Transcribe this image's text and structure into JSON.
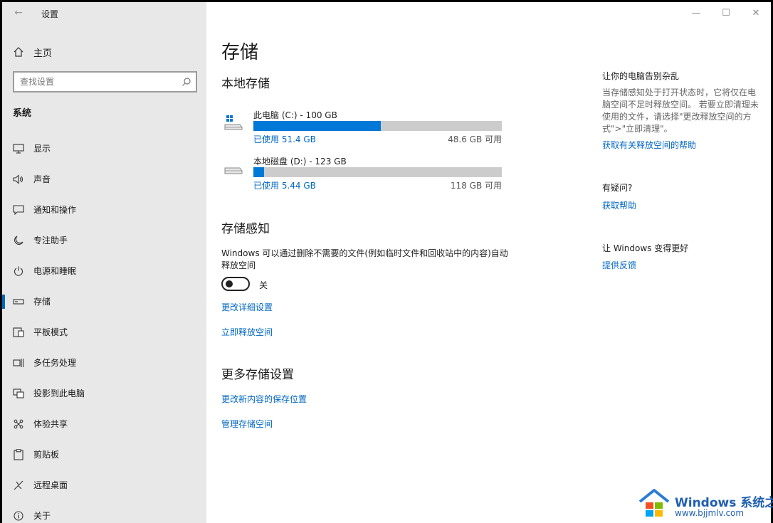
{
  "window": {
    "title": "设置"
  },
  "sidebar": {
    "home_label": "主页",
    "search_placeholder": "查找设置",
    "section": "系统",
    "items": [
      {
        "label": "显示",
        "icon": "monitor-icon"
      },
      {
        "label": "声音",
        "icon": "speaker-icon"
      },
      {
        "label": "通知和操作",
        "icon": "notification-icon"
      },
      {
        "label": "专注助手",
        "icon": "moon-icon"
      },
      {
        "label": "电源和睡眠",
        "icon": "power-icon"
      },
      {
        "label": "存储",
        "icon": "storage-icon",
        "active": true
      },
      {
        "label": "平板模式",
        "icon": "tablet-icon"
      },
      {
        "label": "多任务处理",
        "icon": "multitask-icon"
      },
      {
        "label": "投影到此电脑",
        "icon": "project-icon"
      },
      {
        "label": "体验共享",
        "icon": "share-icon"
      },
      {
        "label": "剪贴板",
        "icon": "clipboard-icon"
      },
      {
        "label": "远程桌面",
        "icon": "remote-icon"
      },
      {
        "label": "关于",
        "icon": "info-icon"
      }
    ]
  },
  "main": {
    "title": "存储",
    "local_storage_heading": "本地存储",
    "drives": [
      {
        "name": "此电脑 (C:) - 100 GB",
        "used": "已使用 51.4 GB",
        "free": "48.6 GB 可用",
        "used_fraction": 0.514
      },
      {
        "name": "本地磁盘 (D:) - 123 GB",
        "used": "已使用 5.44 GB",
        "free": "118 GB 可用",
        "used_fraction": 0.044
      }
    ],
    "storage_sense_heading": "存储感知",
    "storage_sense_desc": "Windows 可以通过删除不需要的文件(例如临时文件和回收站中的内容)自动释放空间",
    "toggle_state": "关",
    "change_settings_link": "更改详细设置",
    "free_now_link": "立即释放空间",
    "more_heading": "更多存储设置",
    "change_save_location_link": "更改新内容的保存位置",
    "manage_spaces_link": "管理存储空间"
  },
  "right": {
    "tip_title": "让你的电脑告别杂乱",
    "tip_desc": "当存储感知处于打开状态时，它将仅在电脑空间不足时释放空间。 若要立即清理未使用的文件，请选择\"更改释放空间的方式\">\"立即清理\"。",
    "tip_link": "获取有关释放空间的帮助",
    "question_title": "有疑问?",
    "help_link": "获取帮助",
    "improve_title": "让 Windows 变得更好",
    "feedback_link": "提供反馈"
  },
  "watermark": {
    "brand": "Windows 系统之家",
    "url": "www.bjjmlv.com"
  },
  "colors": {
    "accent": "#0078d7",
    "link": "#0067c0",
    "sidebar_bg": "#e8e8e8"
  }
}
